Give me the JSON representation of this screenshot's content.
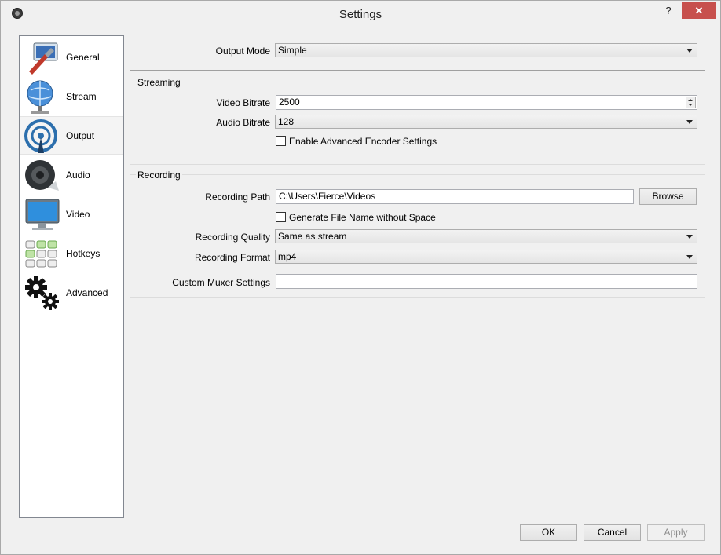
{
  "window": {
    "title": "Settings",
    "help_glyph": "?",
    "close_glyph": "✕"
  },
  "sidebar": {
    "items": [
      {
        "label": "General",
        "icon": "general-icon"
      },
      {
        "label": "Stream",
        "icon": "stream-icon"
      },
      {
        "label": "Output",
        "icon": "output-icon",
        "selected": true
      },
      {
        "label": "Audio",
        "icon": "audio-icon"
      },
      {
        "label": "Video",
        "icon": "video-icon"
      },
      {
        "label": "Hotkeys",
        "icon": "hotkeys-icon"
      },
      {
        "label": "Advanced",
        "icon": "advanced-icon"
      }
    ]
  },
  "output": {
    "mode_label": "Output Mode",
    "mode_value": "Simple"
  },
  "streaming": {
    "title": "Streaming",
    "video_bitrate_label": "Video Bitrate",
    "video_bitrate_value": "2500",
    "audio_bitrate_label": "Audio Bitrate",
    "audio_bitrate_value": "128",
    "advanced_encoder_label": "Enable Advanced Encoder Settings",
    "advanced_encoder_checked": false
  },
  "recording": {
    "title": "Recording",
    "path_label": "Recording Path",
    "path_value": "C:\\Users\\Fierce\\Videos",
    "browse_label": "Browse",
    "nospace_label": "Generate File Name without Space",
    "nospace_checked": false,
    "quality_label": "Recording Quality",
    "quality_value": "Same as stream",
    "format_label": "Recording Format",
    "format_value": "mp4",
    "muxer_label": "Custom Muxer Settings",
    "muxer_value": ""
  },
  "footer": {
    "ok_label": "OK",
    "cancel_label": "Cancel",
    "apply_label": "Apply"
  }
}
